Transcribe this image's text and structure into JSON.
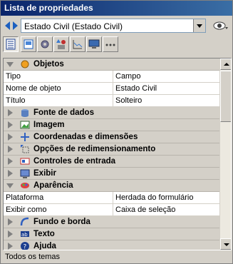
{
  "window": {
    "title": "Lista de propriedades"
  },
  "selector": {
    "value": "Estado Civil (Estado Civil)"
  },
  "toolbar": {
    "buttons": [
      "list-view-icon",
      "form-icon",
      "gear-icon",
      "shapes-icon",
      "chart-icon",
      "monitor-icon",
      "more-icon"
    ]
  },
  "grid": {
    "sections": [
      {
        "label": "Objetos",
        "expanded": true,
        "icon": "objects-icon",
        "props": [
          {
            "k": "Tipo",
            "v": "Campo"
          },
          {
            "k": "Nome de objeto",
            "v": "Estado Civil"
          },
          {
            "k": "Título",
            "v": "Solteiro"
          }
        ]
      },
      {
        "label": "Fonte de dados",
        "expanded": false,
        "icon": "datasource-icon"
      },
      {
        "label": "Imagem",
        "expanded": false,
        "icon": "image-icon"
      },
      {
        "label": "Coordenadas e dimensões",
        "expanded": false,
        "icon": "coordinates-icon"
      },
      {
        "label": "Opções de redimensionamento",
        "expanded": false,
        "icon": "resize-icon"
      },
      {
        "label": "Controles de entrada",
        "expanded": false,
        "icon": "input-controls-icon"
      },
      {
        "label": "Exibir",
        "expanded": false,
        "icon": "display-icon"
      },
      {
        "label": "Aparência",
        "expanded": true,
        "icon": "appearance-icon",
        "props": [
          {
            "k": "Plataforma",
            "v": "Herdada do formulário"
          },
          {
            "k": "Exibir como",
            "v": "Caixa de seleção"
          }
        ]
      },
      {
        "label": "Fundo e borda",
        "expanded": false,
        "icon": "background-border-icon"
      },
      {
        "label": "Texto",
        "expanded": false,
        "icon": "text-icon"
      },
      {
        "label": "Ajuda",
        "expanded": false,
        "icon": "help-icon"
      }
    ]
  },
  "status": {
    "text": "Todos os temas"
  },
  "colors": {
    "titlebar": "#0a246a",
    "panel": "#d4d0c8",
    "border": "#808080"
  }
}
